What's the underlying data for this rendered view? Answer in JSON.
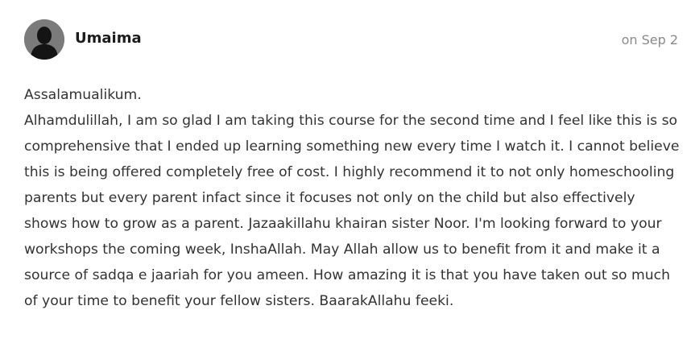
{
  "comment": {
    "avatar_icon": "user-silhouette-icon",
    "author": "Umaima",
    "date": "on Sep 2",
    "greeting": "Assalamualikum.",
    "body": "Alhamdulillah, I am so glad I am taking this course for the second time and I feel like this is so comprehensive that I ended up learning something new every time I watch it. I cannot believe this is being offered completely free of cost. I highly recommend it to not only homeschooling parents but every parent infact since it focuses not only on the child but also effectively shows how to grow as a parent. Jazaakillahu khairan sister Noor. I'm looking forward to your workshops the coming week, InshaAllah. May Allah allow us to benefit from it and make it a source of sadqa e jaariah for you ameen. How amazing it is that you have taken out so much of your time to benefit your fellow sisters. BaarakAllahu feeki."
  }
}
